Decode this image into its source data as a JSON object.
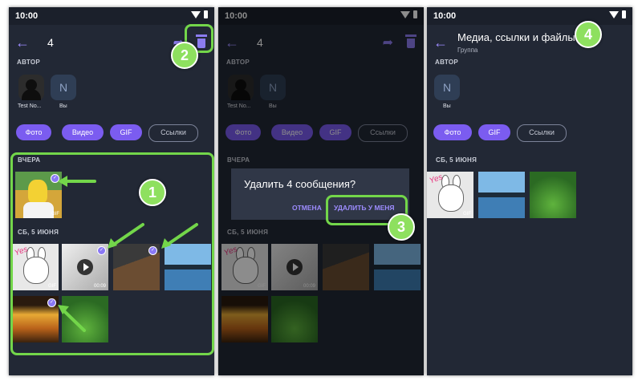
{
  "status": {
    "time": "10:00"
  },
  "panel1": {
    "selected_count": "4",
    "author_label": "АВТОР",
    "authors": [
      {
        "name": "Test No..."
      },
      {
        "initial": "N",
        "name": "Вы"
      }
    ],
    "chips": [
      "Фото",
      "Видео",
      "GIF",
      "Ссылки"
    ],
    "section_yesterday": "ВЧЕРА",
    "section_june5": "СБ, 5 ИЮНЯ",
    "gif_tag": "GIF",
    "video_duration": "00:09",
    "check": "✓"
  },
  "panel2": {
    "selected_count": "4",
    "author_label": "АВТОР",
    "authors": [
      {
        "name": "Test No..."
      },
      {
        "initial": "N",
        "name": "Вы"
      }
    ],
    "chips": [
      "Фото",
      "Видео",
      "GIF",
      "Ссылки"
    ],
    "section_yesterday": "ВЧЕРА",
    "section_june5": "СБ, 5 ИЮНЯ",
    "gif_tag": "GIF",
    "video_duration": "00:09",
    "dialog_title": "Удалить 4 сообщения?",
    "dialog_cancel": "ОТМЕНА",
    "dialog_delete": "УДАЛИТЬ У МЕНЯ"
  },
  "panel3": {
    "title": "Медиа, ссылки и файлы",
    "subtitle": "Группа",
    "author_label": "АВТОР",
    "authors": [
      {
        "initial": "N",
        "name": "Вы"
      }
    ],
    "chips": [
      "Фото",
      "GIF",
      "Ссылки"
    ],
    "section_june5": "СБ, 5 ИЮНЯ",
    "gif_tag": "GIF"
  },
  "steps": [
    "1",
    "2",
    "3",
    "4"
  ],
  "colors": {
    "accent": "#7b5cf0",
    "highlight": "#73d64a",
    "background": "#222835"
  }
}
